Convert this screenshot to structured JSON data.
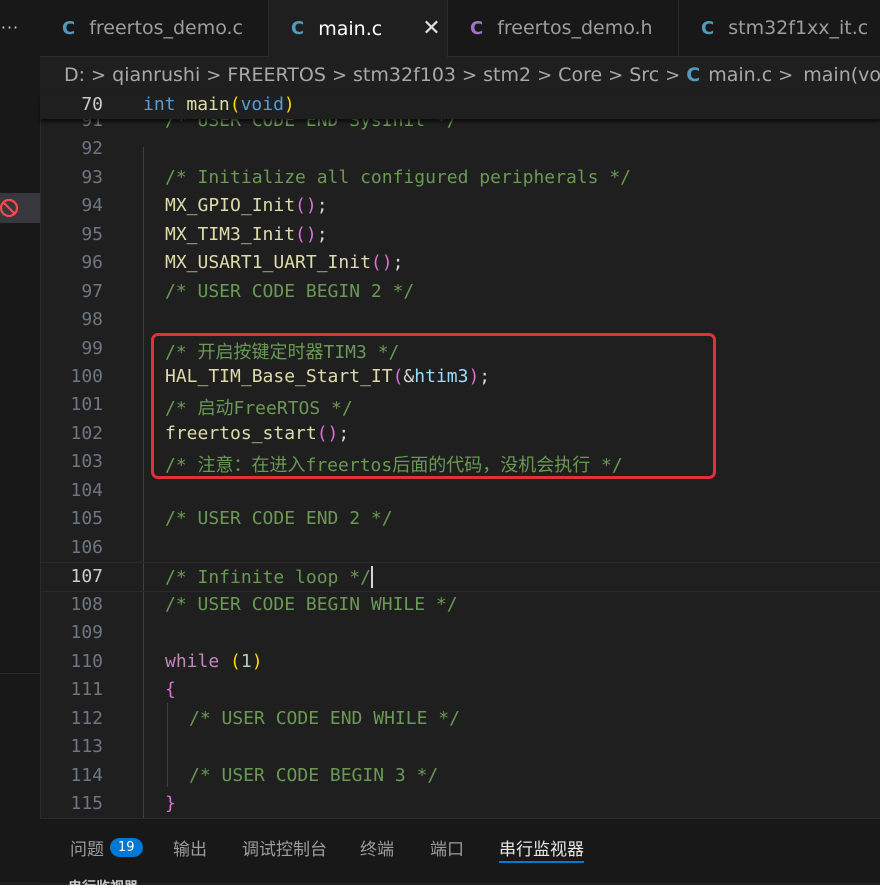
{
  "sidebar": {
    "more_label": "···"
  },
  "tabs": [
    {
      "letter": "C",
      "name": "freertos_demo.c",
      "active": false
    },
    {
      "letter": "C",
      "name": "main.c",
      "active": true,
      "close": "✕"
    },
    {
      "letter": "C",
      "name": "freertos_demo.h",
      "active": false
    },
    {
      "letter": "C",
      "name": "stm32f1xx_it.c",
      "active": false
    }
  ],
  "breadcrumb": {
    "items": [
      "D:",
      "qianrushi",
      "FREERTOS",
      "stm32f103",
      "stm2",
      "Core",
      "Src"
    ],
    "file_icon": "C",
    "file": "main.c",
    "symbol": "main(void)",
    "separator": ">"
  },
  "sticky": {
    "line": "70",
    "kw_int": "int",
    "fn_main": "main",
    "paren_open": "(",
    "kw_void": "void",
    "paren_close": ")"
  },
  "editor": {
    "lines": [
      {
        "n": "91",
        "partial": "/* USER CODE END SysInit */"
      },
      {
        "n": "92"
      },
      {
        "n": "93",
        "comment": "/* Initialize all configured peripherals */"
      },
      {
        "n": "94",
        "fn": "MX_GPIO_Init",
        "paren": "()",
        "semi": ";"
      },
      {
        "n": "95",
        "fn": "MX_TIM3_Init",
        "paren": "()",
        "semi": ";"
      },
      {
        "n": "96",
        "fn": "MX_USART1_UART_Init",
        "paren": "()",
        "semi": ";"
      },
      {
        "n": "97",
        "comment": "/* USER CODE BEGIN 2 */"
      },
      {
        "n": "98"
      },
      {
        "n": "99",
        "comment": "/* 开启按键定时器TIM3 */"
      },
      {
        "n": "100",
        "fn": "HAL_TIM_Base_Start_IT",
        "p_open": "(",
        "amp": "&",
        "var": "htim3",
        "p_close": ")",
        "semi": ";"
      },
      {
        "n": "101",
        "comment": "/* 启动FreeRTOS */"
      },
      {
        "n": "102",
        "fn": "freertos_start",
        "paren": "()",
        "semi": ";"
      },
      {
        "n": "103",
        "comment": "/* 注意：在进入freertos后面的代码，没机会执行 */"
      },
      {
        "n": "104"
      },
      {
        "n": "105",
        "comment": "/* USER CODE END 2 */"
      },
      {
        "n": "106"
      },
      {
        "n": "107",
        "comment": "/* Infinite loop */"
      },
      {
        "n": "108",
        "comment": "/* USER CODE BEGIN WHILE */"
      },
      {
        "n": "109"
      },
      {
        "n": "110",
        "kw": "while",
        "p_open": "(",
        "num": "1",
        "p_close": ")"
      },
      {
        "n": "111",
        "brace": "{"
      },
      {
        "n": "112",
        "comment": "/* USER CODE END WHILE */"
      },
      {
        "n": "113"
      },
      {
        "n": "114",
        "comment": "/* USER CODE BEGIN 3 */"
      },
      {
        "n": "115",
        "brace": "}"
      }
    ]
  },
  "panel": {
    "tabs": [
      "问题",
      "输出",
      "调试控制台",
      "终端",
      "端口",
      "串行监视器"
    ],
    "problems_count": "19",
    "sub_title": "串行监视器"
  },
  "colors": {
    "accent": "#0078d4",
    "highlight_box": "#e0303a",
    "comment": "#6a9955",
    "function": "#dcdcaa",
    "keyword": "#569cd6"
  }
}
